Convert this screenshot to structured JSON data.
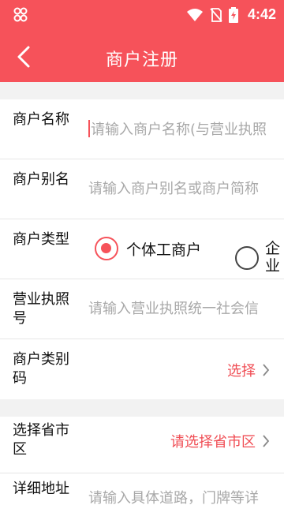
{
  "status": {
    "time": "4:42"
  },
  "appbar": {
    "title": "商户注册"
  },
  "form": {
    "merchant_name": {
      "label": "商户名称",
      "placeholder": "请输入商户名称(与营业执照"
    },
    "merchant_alias": {
      "label": "商户别名",
      "placeholder": "请输入商户别名或商户简称"
    },
    "merchant_type": {
      "label": "商户类型",
      "options": [
        {
          "label": "个体工商户",
          "selected": true
        },
        {
          "label": "企业",
          "selected": false
        }
      ]
    },
    "license_no": {
      "label": "营业执照号",
      "placeholder": "请输入营业执照统一社会信"
    },
    "category_code": {
      "label": "商户类别码",
      "action": "选择"
    },
    "region": {
      "label": "选择省市区",
      "action": "请选择省市区"
    },
    "address": {
      "label": "详细地址",
      "placeholder": "请输入具体道路，门牌等详"
    }
  },
  "colors": {
    "accent": "#f6525a",
    "background_gap": "#f2f2f2"
  },
  "icons": [
    "app-icon",
    "wifi-icon",
    "no-sim-icon",
    "battery-icon",
    "back-arrow-icon",
    "chevron-right-icon"
  ]
}
